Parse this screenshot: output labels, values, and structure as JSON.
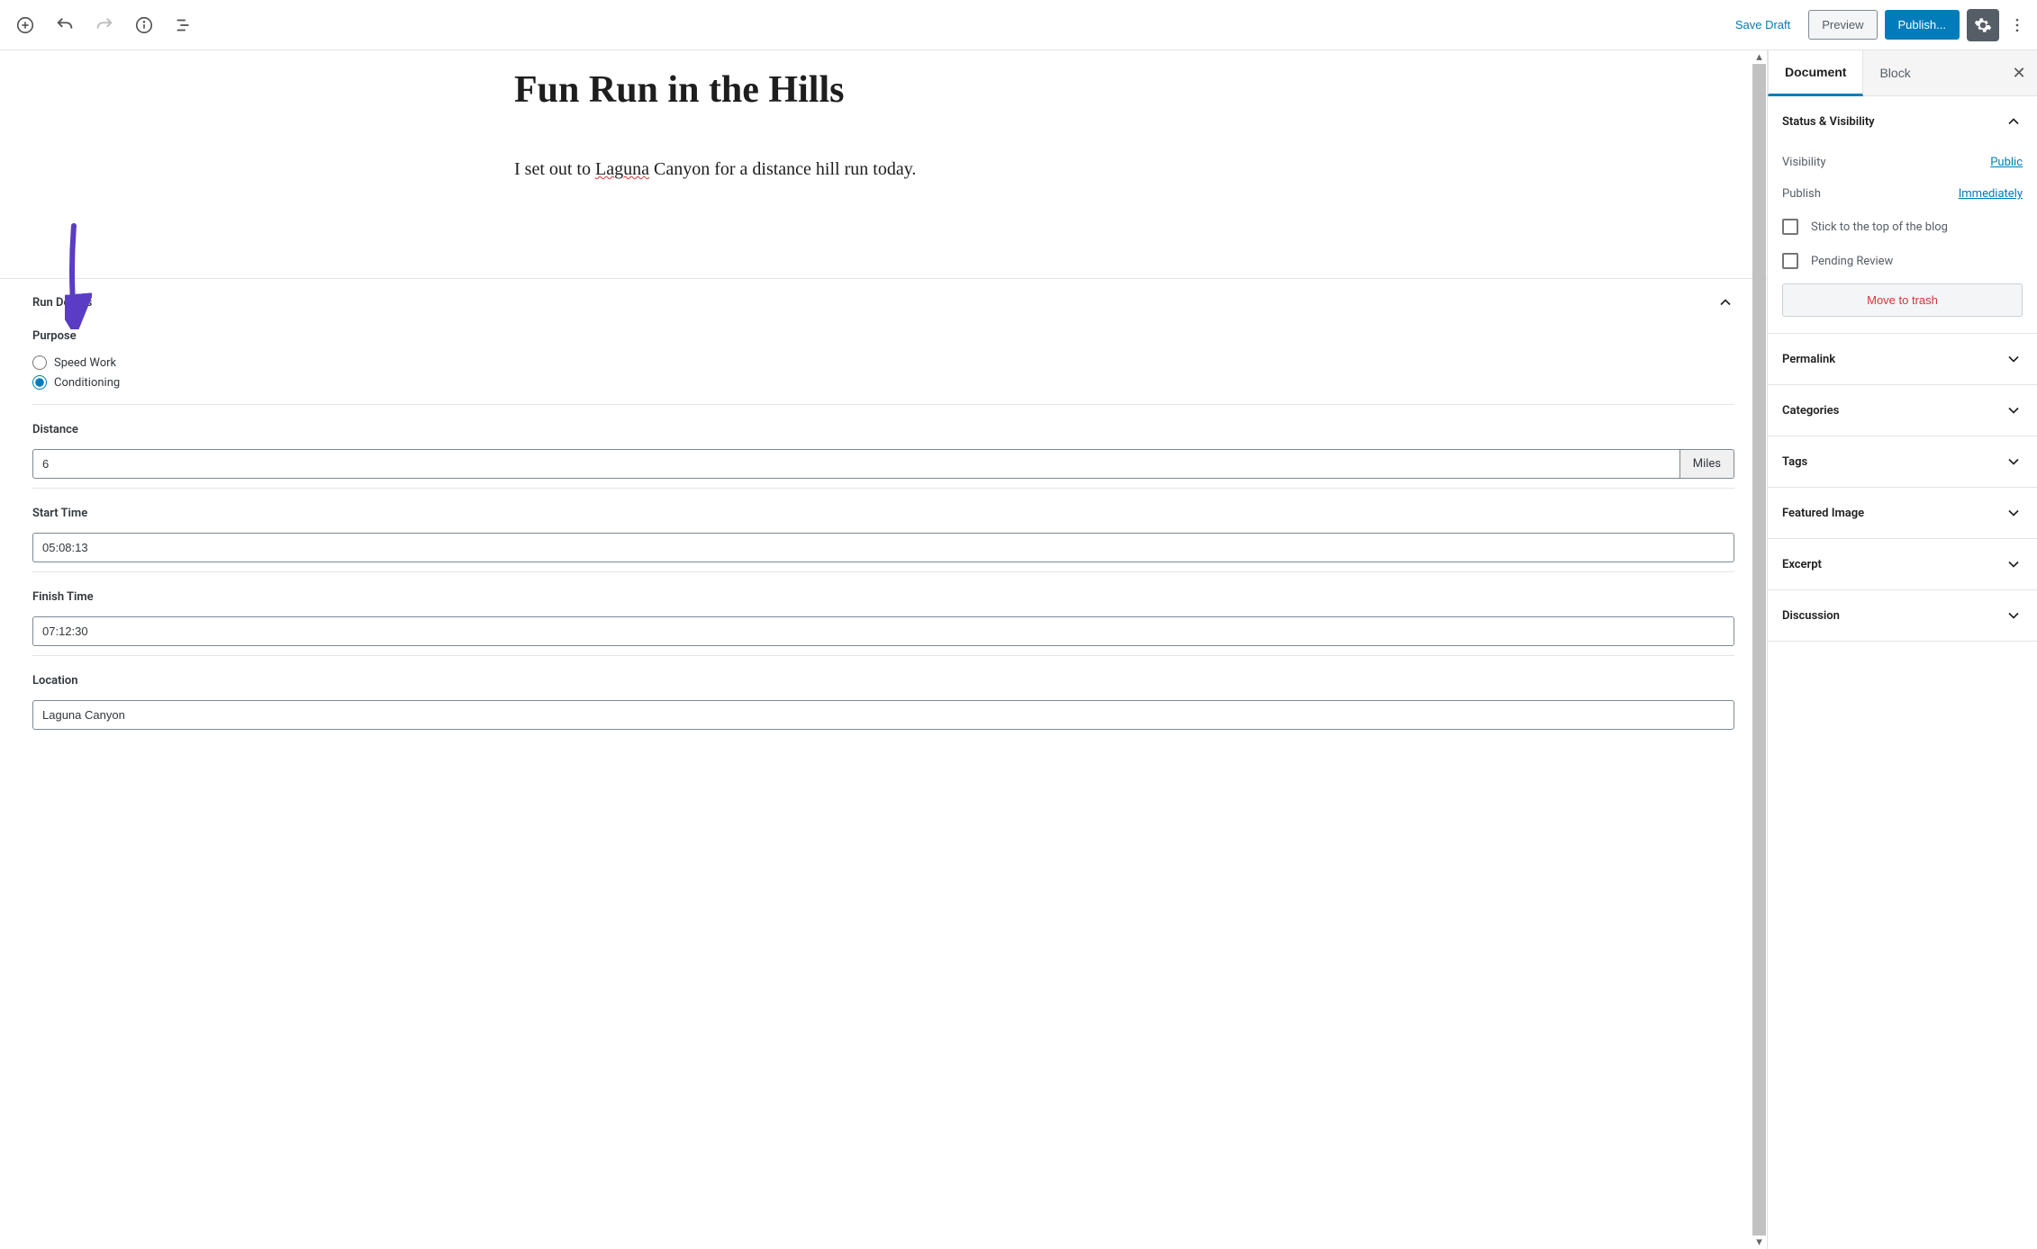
{
  "toolbar": {
    "save_draft": "Save Draft",
    "preview": "Preview",
    "publish": "Publish..."
  },
  "post": {
    "title": "Fun Run in the Hills",
    "body_prefix": "I set out to ",
    "body_underlined": "Laguna",
    "body_suffix": " Canyon for a distance hill run today."
  },
  "metabox": {
    "title": "Run Details",
    "fields": {
      "purpose": {
        "label": "Purpose",
        "options": [
          "Speed Work",
          "Conditioning"
        ],
        "selected": "Conditioning"
      },
      "distance": {
        "label": "Distance",
        "value": "6",
        "unit": "Miles"
      },
      "start_time": {
        "label": "Start Time",
        "value": "05:08:13"
      },
      "finish_time": {
        "label": "Finish Time",
        "value": "07:12:30"
      },
      "location": {
        "label": "Location",
        "value": "Laguna Canyon"
      }
    }
  },
  "sidebar": {
    "tabs": {
      "document": "Document",
      "block": "Block"
    },
    "status": {
      "title": "Status & Visibility",
      "visibility_label": "Visibility",
      "visibility_value": "Public",
      "publish_label": "Publish",
      "publish_value": "Immediately",
      "stick_label": "Stick to the top of the blog",
      "pending_label": "Pending Review",
      "trash": "Move to trash"
    },
    "panels": {
      "permalink": "Permalink",
      "categories": "Categories",
      "tags": "Tags",
      "featured_image": "Featured Image",
      "excerpt": "Excerpt",
      "discussion": "Discussion"
    }
  }
}
